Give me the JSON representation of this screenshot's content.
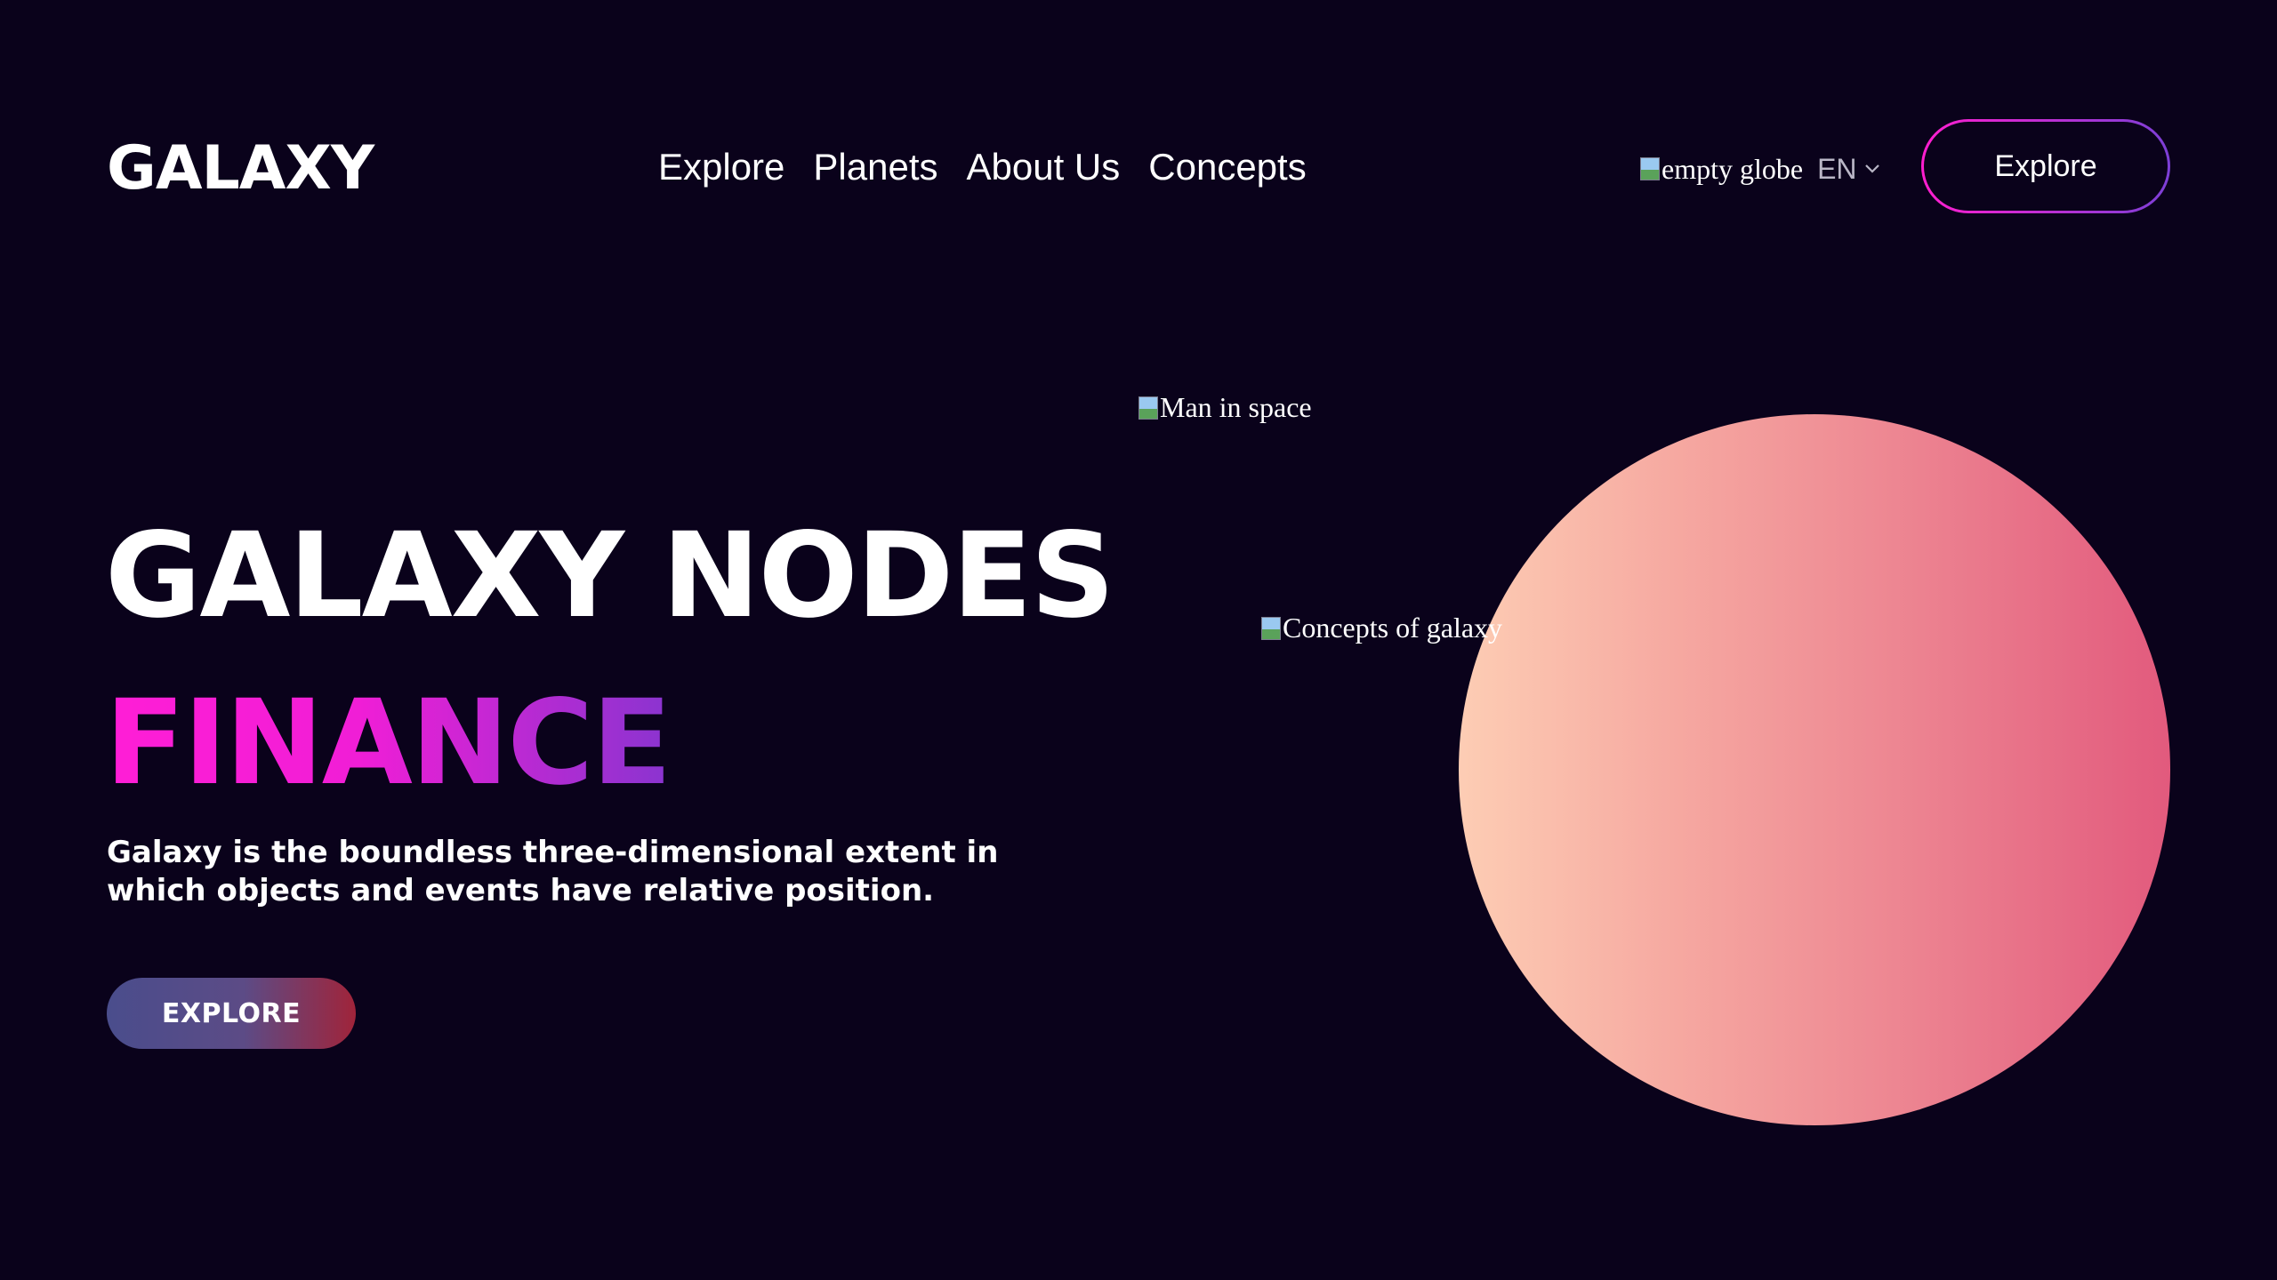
{
  "header": {
    "logo": "GALAXY",
    "nav": [
      "Explore",
      "Planets",
      "About Us",
      "Concepts"
    ],
    "globe_image_alt": "empty globe",
    "language": "EN",
    "explore_button": "Explore"
  },
  "hero": {
    "title_line1": "GALAXY NODES",
    "title_line2": "FINANCE",
    "description": "Galaxy is the boundless three-dimensional extent in which objects and events have relative position.",
    "cta_label": "EXPLORE"
  },
  "images": {
    "man_alt": "Man in space",
    "concepts_alt": "Concepts of galaxy"
  },
  "icons": {
    "broken_image": "broken-image-icon",
    "language_dropdown": "chevron-down-icon"
  },
  "colors": {
    "background": "#0a021b",
    "accent_pink": "#ff1ed6",
    "accent_purple": "#8a34d0",
    "planet_start": "#fdcdb4",
    "planet_end": "#e25a7d"
  }
}
